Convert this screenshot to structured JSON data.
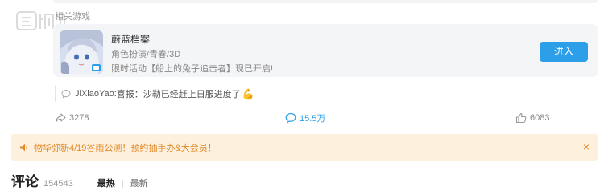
{
  "related": {
    "label": "相关游戏"
  },
  "game": {
    "title": "蔚蓝档案",
    "tags": "角色扮演/青春/3D",
    "event": "限时活动【船上的兔子追击者】现已开启!",
    "enter_label": "进入"
  },
  "quote": {
    "user": "JiXiaoYao",
    "sep": ":",
    "text": "喜报：沙勒已经赶上日服进度了",
    "emoji": "💪"
  },
  "stats": {
    "shares": "3278",
    "comments": "15.5万",
    "likes": "6083"
  },
  "notice": {
    "text": "物华弥新4/19谷雨公测！预约抽手办&大会员！",
    "close": "×"
  },
  "comments": {
    "title": "评论",
    "count": "154543",
    "sort_hot": "最热",
    "sort_sep": "|",
    "sort_new": "最新"
  },
  "colors": {
    "accent": "#2d9ee8",
    "notice_bg": "#fdf0dc",
    "notice_text": "#e0892a"
  }
}
